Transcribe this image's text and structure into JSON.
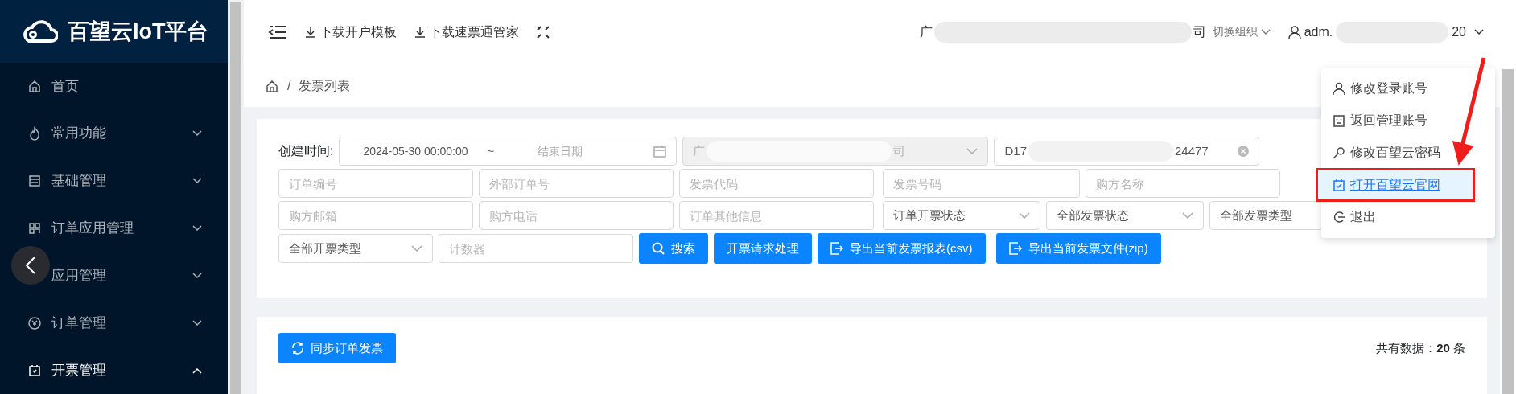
{
  "logo": {
    "text": "百望云IoT平台"
  },
  "sidebar": {
    "items": [
      {
        "label": "首页",
        "expandable": false,
        "expanded": false
      },
      {
        "label": "常用功能",
        "expandable": true,
        "expanded": false
      },
      {
        "label": "基础管理",
        "expandable": true,
        "expanded": false
      },
      {
        "label": "订单应用管理",
        "expandable": true,
        "expanded": false
      },
      {
        "label": "应用管理",
        "expandable": true,
        "expanded": false
      },
      {
        "label": "订单管理",
        "expandable": true,
        "expanded": false
      },
      {
        "label": "开票管理",
        "expandable": true,
        "expanded": true
      }
    ]
  },
  "header": {
    "links": [
      {
        "label": "下载开户模板"
      },
      {
        "label": "下载速票通管家"
      }
    ],
    "org": {
      "prefix": "广",
      "suffix": "司",
      "switch_label": "切换组织"
    },
    "user": {
      "prefix": "adm.",
      "suffix": "20"
    }
  },
  "breadcrumb": {
    "separator": "/",
    "current": "发票列表"
  },
  "user_menu": {
    "items": [
      {
        "label": "修改登录账号",
        "selected": false,
        "annotated": false
      },
      {
        "label": "返回管理账号",
        "selected": false,
        "annotated": false
      },
      {
        "label": "修改百望云密码",
        "selected": false,
        "annotated": false
      },
      {
        "label": "打开百望云官网",
        "selected": true,
        "annotated": true
      },
      {
        "label": "退出",
        "selected": false,
        "annotated": false
      }
    ]
  },
  "filters": {
    "date_label": "创建时间:",
    "date_start": "2024-05-30 00:00:00",
    "date_separator": "~",
    "date_end_placeholder": "结束日期",
    "org_select": {
      "prefix": "广",
      "suffix": "司",
      "disabled": true
    },
    "order_search": {
      "prefix": "D17",
      "suffix": "24477"
    },
    "rows": [
      [
        {
          "kind": "input",
          "placeholder": "订单编号"
        },
        {
          "kind": "input",
          "placeholder": "外部订单号"
        },
        {
          "kind": "input",
          "placeholder": "发票代码"
        },
        {
          "kind": "input",
          "placeholder": "发票号码"
        },
        {
          "kind": "input",
          "placeholder": "购方名称"
        }
      ],
      [
        {
          "kind": "input",
          "placeholder": "购方邮箱"
        },
        {
          "kind": "input",
          "placeholder": "购方电话"
        },
        {
          "kind": "input",
          "placeholder": "订单其他信息"
        },
        {
          "kind": "select",
          "value": "订单开票状态"
        },
        {
          "kind": "select",
          "value": "全部发票状态"
        },
        {
          "kind": "select",
          "value": "全部发票类型"
        }
      ],
      [
        {
          "kind": "select",
          "value": "全部开票类型"
        },
        {
          "kind": "input",
          "placeholder": "计数器"
        }
      ]
    ],
    "buttons": [
      {
        "kind": "search",
        "label": "搜索"
      },
      {
        "kind": "plain",
        "label": "开票请求处理"
      },
      {
        "kind": "export",
        "label": "导出当前发票报表(csv)"
      },
      {
        "kind": "export",
        "label": "导出当前发票文件(zip)"
      }
    ]
  },
  "table": {
    "sync_button": "同步订单发票",
    "total": "共有数据：**20** 条"
  }
}
